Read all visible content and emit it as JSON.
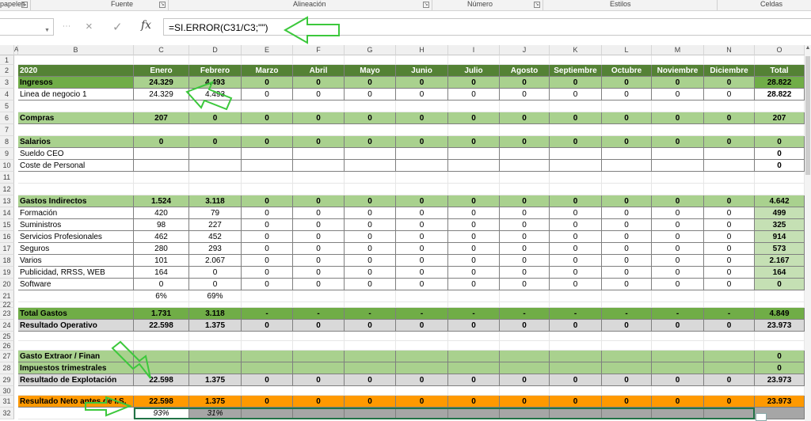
{
  "ribbon": {
    "groups": [
      {
        "label": "papeles",
        "name": "portapapeles",
        "launcher": true
      },
      {
        "label": "Fuente",
        "name": "fuente",
        "launcher": true
      },
      {
        "label": "Alineación",
        "name": "alineacion",
        "launcher": true
      },
      {
        "label": "Número",
        "name": "numero",
        "launcher": true
      },
      {
        "label": "Estilos",
        "name": "estilos",
        "launcher": false
      },
      {
        "label": "Celdas",
        "name": "celdas",
        "launcher": false
      }
    ]
  },
  "formula_bar": {
    "name_box": "",
    "formula": "=SI.ERROR(C31/C3;\"\")",
    "cancel_icon": "×",
    "enter_icon": "✓",
    "fx_label": "fx"
  },
  "columns": [
    "A",
    "B",
    "C",
    "D",
    "E",
    "F",
    "G",
    "H",
    "I",
    "J",
    "K",
    "L",
    "M",
    "N",
    "O"
  ],
  "rows": [
    {
      "n": "1",
      "style": "empty",
      "cells": []
    },
    {
      "n": "2",
      "style": "header",
      "cells": [
        "",
        "2020",
        "Enero",
        "Febrero",
        "Marzo",
        "Abril",
        "Mayo",
        "Junio",
        "Julio",
        "Agosto",
        "Septiembre",
        "Octubre",
        "Noviembre",
        "Diciembre",
        "Total"
      ]
    },
    {
      "n": "3",
      "style": "section-bold",
      "cells": [
        "",
        "Ingresos",
        "24.329",
        "4.493",
        "0",
        "0",
        "0",
        "0",
        "0",
        "0",
        "0",
        "0",
        "0",
        "0",
        "28.822"
      ]
    },
    {
      "n": "4",
      "style": "detail",
      "cells": [
        "",
        "Linea de negocio 1",
        "24.329",
        "4.493",
        "0",
        "0",
        "0",
        "0",
        "0",
        "0",
        "0",
        "0",
        "0",
        "0",
        "28.822"
      ]
    },
    {
      "n": "5",
      "style": "empty",
      "cells": []
    },
    {
      "n": "6",
      "style": "section",
      "cells": [
        "",
        "Compras",
        "207",
        "0",
        "0",
        "0",
        "0",
        "0",
        "0",
        "0",
        "0",
        "0",
        "0",
        "0",
        "207"
      ]
    },
    {
      "n": "7",
      "style": "empty",
      "cells": []
    },
    {
      "n": "8",
      "style": "section",
      "cells": [
        "",
        "Salarios",
        "0",
        "0",
        "0",
        "0",
        "0",
        "0",
        "0",
        "0",
        "0",
        "0",
        "0",
        "0",
        "0"
      ]
    },
    {
      "n": "9",
      "style": "detail",
      "cells": [
        "",
        "Sueldo CEO",
        "",
        "",
        "",
        "",
        "",
        "",
        "",
        "",
        "",
        "",
        "",
        "",
        "0"
      ]
    },
    {
      "n": "10",
      "style": "detail",
      "cells": [
        "",
        "Coste de Personal",
        "",
        "",
        "",
        "",
        "",
        "",
        "",
        "",
        "",
        "",
        "",
        "",
        "0"
      ]
    },
    {
      "n": "11",
      "style": "empty",
      "cells": []
    },
    {
      "n": "12",
      "style": "empty",
      "cells": []
    },
    {
      "n": "13",
      "style": "section",
      "cells": [
        "",
        "Gastos Indirectos",
        "1.524",
        "3.118",
        "0",
        "0",
        "0",
        "0",
        "0",
        "0",
        "0",
        "0",
        "0",
        "0",
        "4.642"
      ]
    },
    {
      "n": "14",
      "style": "detail",
      "cells": [
        "",
        "Formación",
        "420",
        "79",
        "0",
        "0",
        "0",
        "0",
        "0",
        "0",
        "0",
        "0",
        "0",
        "0",
        "499"
      ]
    },
    {
      "n": "15",
      "style": "detail",
      "cells": [
        "",
        "Suministros",
        "98",
        "227",
        "0",
        "0",
        "0",
        "0",
        "0",
        "0",
        "0",
        "0",
        "0",
        "0",
        "325"
      ]
    },
    {
      "n": "16",
      "style": "detail",
      "cells": [
        "",
        "Servicios Profesionales",
        "462",
        "452",
        "0",
        "0",
        "0",
        "0",
        "0",
        "0",
        "0",
        "0",
        "0",
        "0",
        "914"
      ]
    },
    {
      "n": "17",
      "style": "detail",
      "cells": [
        "",
        "Seguros",
        "280",
        "293",
        "0",
        "0",
        "0",
        "0",
        "0",
        "0",
        "0",
        "0",
        "0",
        "0",
        "573"
      ]
    },
    {
      "n": "18",
      "style": "detail",
      "cells": [
        "",
        "Varios",
        "101",
        "2.067",
        "0",
        "0",
        "0",
        "0",
        "0",
        "0",
        "0",
        "0",
        "0",
        "0",
        "2.167"
      ]
    },
    {
      "n": "19",
      "style": "detail",
      "cells": [
        "",
        "Publicidad, RRSS, WEB",
        "164",
        "0",
        "0",
        "0",
        "0",
        "0",
        "0",
        "0",
        "0",
        "0",
        "0",
        "0",
        "164"
      ]
    },
    {
      "n": "20",
      "style": "detail",
      "cells": [
        "",
        "Software",
        "0",
        "0",
        "0",
        "0",
        "0",
        "0",
        "0",
        "0",
        "0",
        "0",
        "0",
        "0",
        "0"
      ]
    },
    {
      "n": "21",
      "style": "pct",
      "cells": [
        "",
        "",
        "6%",
        "69%",
        "",
        "",
        "",
        "",
        "",
        "",
        "",
        "",
        "",
        "",
        ""
      ]
    },
    {
      "n": "22",
      "style": "empty",
      "cells": []
    },
    {
      "n": "23",
      "style": "total-green",
      "cells": [
        "",
        "Total Gastos",
        "1.731",
        "3.118",
        "-",
        "-",
        "-",
        "-",
        "-",
        "-",
        "-",
        "-",
        "-",
        "-",
        "4.849"
      ]
    },
    {
      "n": "24",
      "style": "total-gray",
      "cells": [
        "",
        "Resultado Operativo",
        "22.598",
        "1.375",
        "0",
        "0",
        "0",
        "0",
        "0",
        "0",
        "0",
        "0",
        "0",
        "0",
        "23.973"
      ]
    },
    {
      "n": "25",
      "style": "empty",
      "cells": []
    },
    {
      "n": "26",
      "style": "empty",
      "cells": []
    },
    {
      "n": "27",
      "style": "section-light",
      "cells": [
        "",
        "Gasto Extraor / Finan",
        "",
        "",
        "",
        "",
        "",
        "",
        "",
        "",
        "",
        "",
        "",
        "",
        "0"
      ]
    },
    {
      "n": "28",
      "style": "section-light",
      "cells": [
        "",
        "Impuestos trimestrales",
        "",
        "",
        "",
        "",
        "",
        "",
        "",
        "",
        "",
        "",
        "",
        "",
        "0"
      ]
    },
    {
      "n": "29",
      "style": "total-gray",
      "cells": [
        "",
        "Resultado de Explotación",
        "22.598",
        "1.375",
        "0",
        "0",
        "0",
        "0",
        "0",
        "0",
        "0",
        "0",
        "0",
        "0",
        "23.973"
      ]
    },
    {
      "n": "30",
      "style": "empty",
      "cells": []
    },
    {
      "n": "31",
      "style": "total-orange",
      "cells": [
        "",
        "Resultado Neto antes de I.S.",
        "22.598",
        "1.375",
        "0",
        "0",
        "0",
        "0",
        "0",
        "0",
        "0",
        "0",
        "0",
        "0",
        "23.973"
      ]
    },
    {
      "n": "32",
      "style": "pct-selected",
      "cells": [
        "",
        "",
        "93%",
        "31%",
        "",
        "",
        "",
        "",
        "",
        "",
        "",
        "",
        "",
        "",
        ""
      ]
    }
  ],
  "colors": {
    "header_dark_green": "#548235",
    "section_green": "#a9d18e",
    "detail_green": "#c5e0b4",
    "gray_total": "#d9d9d9",
    "orange_total": "#ff9900",
    "annotation_arrow": "#3cc83c"
  },
  "annotations": [
    "arrow-to-formula",
    "arrow-to-d4",
    "arrow-to-c29",
    "arrow-to-c32"
  ]
}
